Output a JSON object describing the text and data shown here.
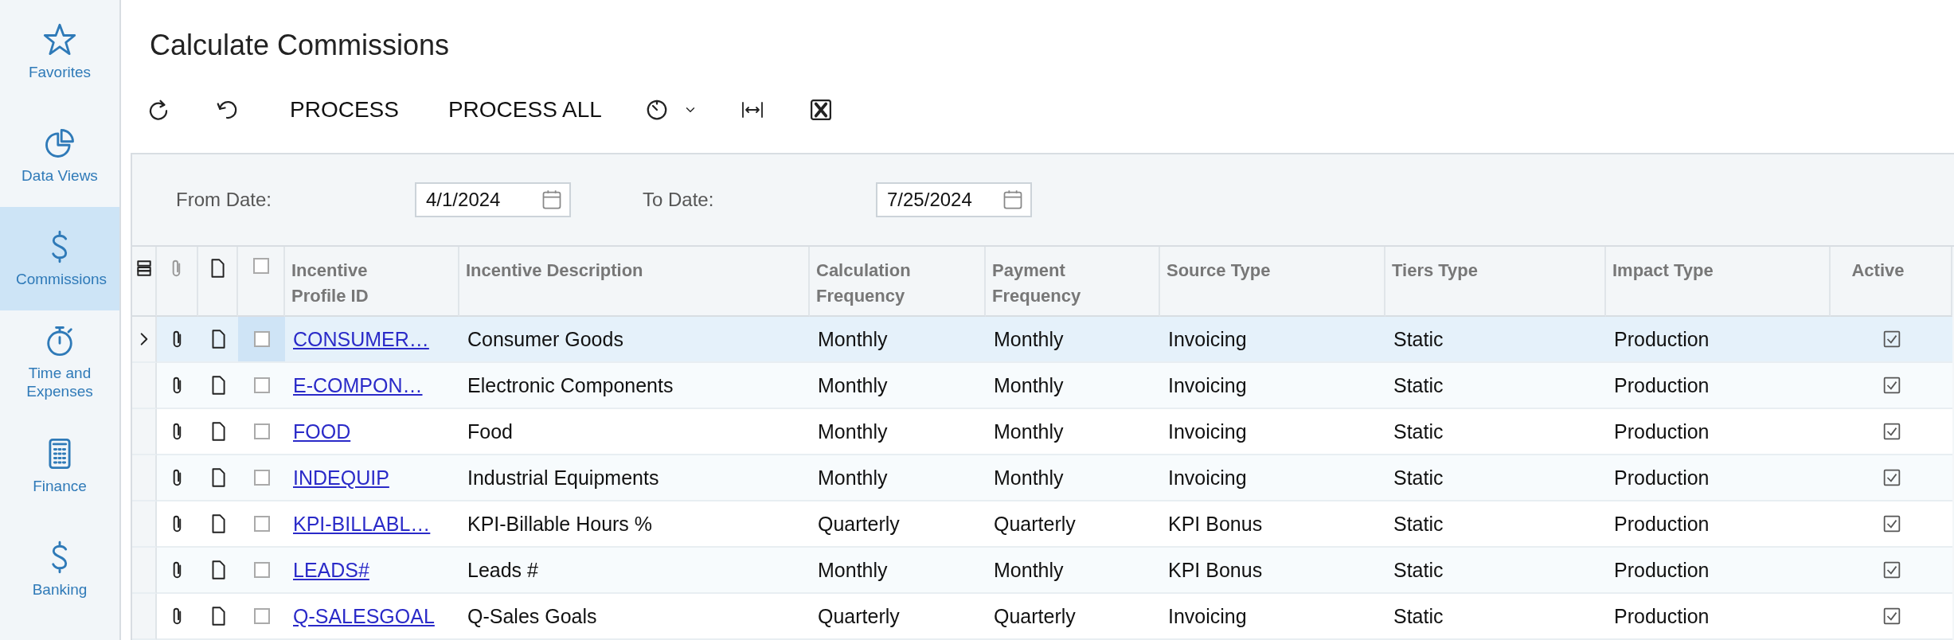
{
  "sidebar": {
    "items": [
      {
        "label": "Favorites",
        "selected": false
      },
      {
        "label": "Data Views",
        "selected": false
      },
      {
        "label": "Commissions",
        "selected": true
      },
      {
        "label": "Time and Expenses",
        "selected": false
      },
      {
        "label": "Finance",
        "selected": false
      },
      {
        "label": "Banking",
        "selected": false
      }
    ]
  },
  "page": {
    "title": "Calculate Commissions"
  },
  "toolbar": {
    "buttons": [
      "PROCESS",
      "PROCESS ALL"
    ]
  },
  "filter": {
    "from_date": {
      "label": "From Date:",
      "value": "4/1/2024"
    },
    "to_date": {
      "label": "To Date:",
      "value": "7/25/2024"
    }
  },
  "table": {
    "columns": [
      "Incentive Profile ID",
      "Incentive Description",
      "Calculation Frequency",
      "Payment Frequency",
      "Source Type",
      "Tiers Type",
      "Impact Type",
      "Active"
    ],
    "header_checked": false,
    "rows": [
      {
        "selected": true,
        "checked": false,
        "id": "CONSUMER…",
        "description": "Consumer Goods",
        "calculation": "Monthly",
        "payment": "Monthly",
        "source": "Invoicing",
        "tiers": "Static",
        "impact": "Production",
        "active": true
      },
      {
        "selected": false,
        "checked": false,
        "id": "E-COMPON…",
        "description": "Electronic Components",
        "calculation": "Monthly",
        "payment": "Monthly",
        "source": "Invoicing",
        "tiers": "Static",
        "impact": "Production",
        "active": true
      },
      {
        "selected": false,
        "checked": false,
        "id": "FOOD",
        "description": "Food",
        "calculation": "Monthly",
        "payment": "Monthly",
        "source": "Invoicing",
        "tiers": "Static",
        "impact": "Production",
        "active": true
      },
      {
        "selected": false,
        "checked": false,
        "id": "INDEQUIP",
        "description": "Industrial Equipments",
        "calculation": "Monthly",
        "payment": "Monthly",
        "source": "Invoicing",
        "tiers": "Static",
        "impact": "Production",
        "active": true
      },
      {
        "selected": false,
        "checked": false,
        "id": "KPI-BILLABL…",
        "description": "KPI-Billable Hours %",
        "calculation": "Quarterly",
        "payment": "Quarterly",
        "source": "KPI Bonus",
        "tiers": "Static",
        "impact": "Production",
        "active": true
      },
      {
        "selected": false,
        "checked": false,
        "id": "LEADS#",
        "description": "Leads #",
        "calculation": "Monthly",
        "payment": "Monthly",
        "source": "KPI Bonus",
        "tiers": "Static",
        "impact": "Production",
        "active": true
      },
      {
        "selected": false,
        "checked": false,
        "id": "Q-SALESGOAL",
        "description": "Q-Sales Goals",
        "calculation": "Quarterly",
        "payment": "Quarterly",
        "source": "Invoicing",
        "tiers": "Static",
        "impact": "Production",
        "active": true
      }
    ]
  }
}
